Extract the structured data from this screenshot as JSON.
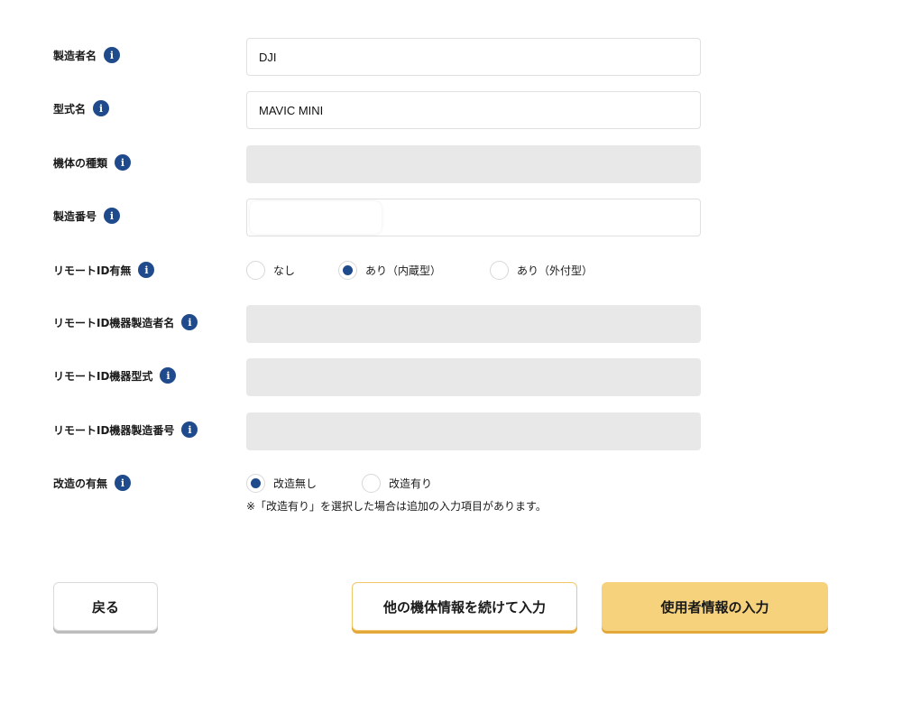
{
  "form": {
    "manufacturer": {
      "label": "製造者名",
      "value": "DJI"
    },
    "model": {
      "label": "型式名",
      "value": "MAVIC MINI"
    },
    "aircraft_type": {
      "label": "機体の種類",
      "value": ""
    },
    "serial_number": {
      "label": "製造番号",
      "value": ""
    },
    "remote_id": {
      "label": "リモートID有無",
      "options": [
        "なし",
        "あり（内蔵型）",
        "あり（外付型）"
      ],
      "selected": "あり（内蔵型）"
    },
    "remote_id_manufacturer": {
      "label": "リモートID機器製造者名",
      "value": ""
    },
    "remote_id_model": {
      "label": "リモートID機器型式",
      "value": ""
    },
    "remote_id_serial": {
      "label": "リモートID機器製造番号",
      "value": ""
    },
    "modification": {
      "label": "改造の有無",
      "options": [
        "改造無し",
        "改造有り"
      ],
      "selected": "改造無し",
      "note": "※「改造有り」を選択した場合は追加の入力項目があります。"
    }
  },
  "info_icon": "i",
  "buttons": {
    "back": "戻る",
    "continue_other": "他の機体情報を続けて入力",
    "next_user": "使用者情報の入力"
  },
  "colors": {
    "accent_blue": "#1f4a8c",
    "primary_button": "#f7d27c",
    "button_shadow": "#e2a93a",
    "disabled_field": "#e8e8e8"
  }
}
